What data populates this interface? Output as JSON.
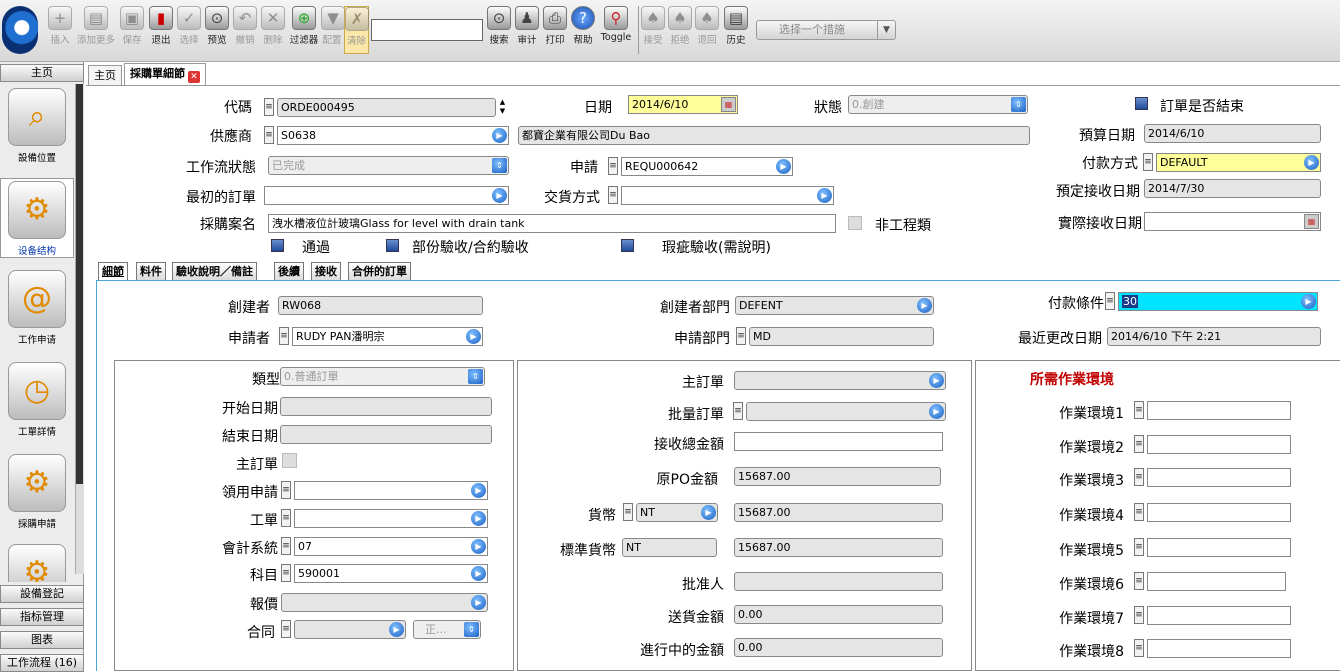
{
  "toolbar": {
    "buttons": [
      "插入",
      "添加更多",
      "保存",
      "退出",
      "选择",
      "预览",
      "撤销",
      "删除",
      "过滤器",
      "配置",
      "清除"
    ],
    "right_buttons": [
      "搜索",
      "审计",
      "打印",
      "帮助",
      "Toggle"
    ],
    "workflow_buttons": [
      "接受",
      "拒绝",
      "退回",
      "历史"
    ],
    "action_select": "选择一个措施"
  },
  "sidebar": {
    "top_tab": "主页",
    "items": [
      "設備位置",
      "设备结构",
      "工作申请",
      "工單詳情",
      "採購申請"
    ],
    "bottom_tabs": [
      "設備登記",
      "指标管理",
      "图表",
      "工作流程 (16)"
    ]
  },
  "tabs": {
    "home": "主页",
    "active": "採購單細節"
  },
  "header": {
    "code_label": "代碼",
    "code_value": "ORDE000495",
    "date_label": "日期",
    "date_value": "2014/6/10",
    "status_label": "狀態",
    "status_value": "0.創建",
    "closed_label": "訂單是否結束",
    "supplier_label": "供應商",
    "supplier_code": "S0638",
    "supplier_name": "都寶企業有限公司Du Bao",
    "budget_date_label": "預算日期",
    "budget_date_value": "2014/6/10",
    "workflow_label": "工作流狀態",
    "workflow_value": "已完成",
    "request_label": "申請",
    "request_value": "REQU000642",
    "payment_label": "付款方式",
    "payment_value": "DEFAULT",
    "orig_order_label": "最初的訂單",
    "delivery_label": "交貨方式",
    "planned_receive_label": "預定接收日期",
    "planned_receive_value": "2014/7/30",
    "case_label": "採購案名",
    "case_value": "洩水槽液位計玻璃Glass for level with drain tank",
    "non_eng_label": "非工程類",
    "actual_receive_label": "實際接收日期",
    "pass_label": "通過",
    "partial_label": "部份驗收/合約驗收",
    "defect_label": "瑕疵驗收(需說明)"
  },
  "subtabs": [
    "細節",
    "料件",
    "驗收說明／備註",
    "後續",
    "接收",
    "合併的訂單"
  ],
  "detail": {
    "creator_label": "創建者",
    "creator_value": "RW068",
    "creator_dept_label": "創建者部門",
    "creator_dept_value": "DEFENT",
    "pay_terms_label": "付款條件",
    "pay_terms_value": "30",
    "requester_label": "申請者",
    "requester_value": "RUDY PAN潘明宗",
    "request_dept_label": "申請部門",
    "request_dept_value": "MD",
    "last_modified_label": "最近更改日期",
    "last_modified_value": "2014/6/10 下午 2:21"
  },
  "left_panel": {
    "type_label": "類型",
    "type_value": "0.普通訂單",
    "start_label": "开始日期",
    "end_label": "結束日期",
    "master_label": "主訂單",
    "claim_label": "領用申請",
    "workorder_label": "工單",
    "acct_label": "會計系統",
    "acct_value": "07",
    "subject_label": "科目",
    "subject_value": "590001",
    "quote_label": "報價",
    "contract_label": "合同",
    "contract_status": "正..."
  },
  "mid_panel": {
    "master_label": "主訂單",
    "batch_label": "批量訂單",
    "received_total_label": "接收總金額",
    "orig_po_label": "原PO金額",
    "orig_po_value": "15687.00",
    "currency_label": "貨幣",
    "currency_value": "NT",
    "currency_amount": "15687.00",
    "std_currency_label": "標準貨幣",
    "std_currency_value": "NT",
    "std_amount": "15687.00",
    "approver_label": "批准人",
    "delivered_label": "送貨金額",
    "delivered_value": "0.00",
    "progress_label": "進行中的金額",
    "progress_value": "0.00"
  },
  "right_panel": {
    "title": "所需作業環境",
    "envs": [
      "作業環境1",
      "作業環境2",
      "作業環境3",
      "作業環境4",
      "作業環境5",
      "作業環境6",
      "作業環境7",
      "作業環境8"
    ]
  },
  "colors": {
    "accent_blue": "#1a5fc4",
    "required_yellow": "#ffff99",
    "focus_cyan": "#00e4ff",
    "title_red": "#c00000"
  }
}
